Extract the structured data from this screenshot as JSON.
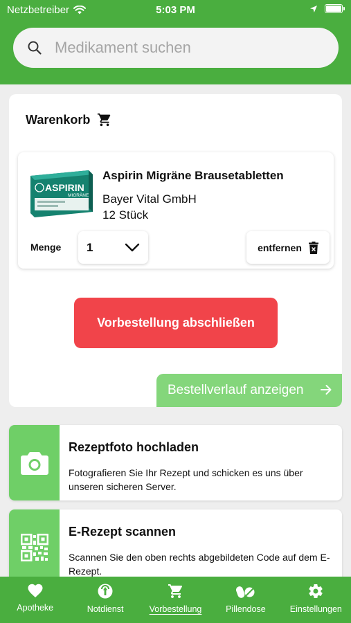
{
  "status_bar": {
    "carrier": "Netzbetreiber",
    "time": "5:03 PM"
  },
  "search": {
    "placeholder": "Medikament suchen"
  },
  "cart": {
    "title": "Warenkorb",
    "item": {
      "name": "Aspirin Migräne Brausetabletten",
      "manufacturer": "Bayer Vital GmbH",
      "quantity_text": "12 Stück",
      "pack_brand": "ASPIRIN",
      "pack_sub": "MIGRÄNE",
      "menge_label": "Menge",
      "menge_value": "1",
      "remove_label": "entfernen"
    },
    "order_button": "Vorbestellung abschließen",
    "history_button": "Bestellverlauf anzeigen"
  },
  "actions": [
    {
      "title": "Rezeptfoto hochladen",
      "description": "Fotografieren Sie Ihr Rezept und schicken es uns über unseren sicheren Server.",
      "icon": "camera-icon"
    },
    {
      "title": "E-Rezept scannen",
      "description": "Scannen Sie den oben rechts abgebildeten Code auf dem E-Rezept.",
      "icon": "qr-code-icon"
    }
  ],
  "tabs": [
    {
      "label": "Apotheke",
      "icon": "heart-icon"
    },
    {
      "label": "Notdienst",
      "icon": "emergency-icon"
    },
    {
      "label": "Vorbestellung",
      "icon": "cart-icon",
      "active": true
    },
    {
      "label": "Pillendose",
      "icon": "pills-icon"
    },
    {
      "label": "Einstellungen",
      "icon": "gear-icon"
    }
  ],
  "colors": {
    "brand_green": "#4aae3f",
    "light_green": "#6fcf67",
    "order_red": "#f1444a"
  }
}
